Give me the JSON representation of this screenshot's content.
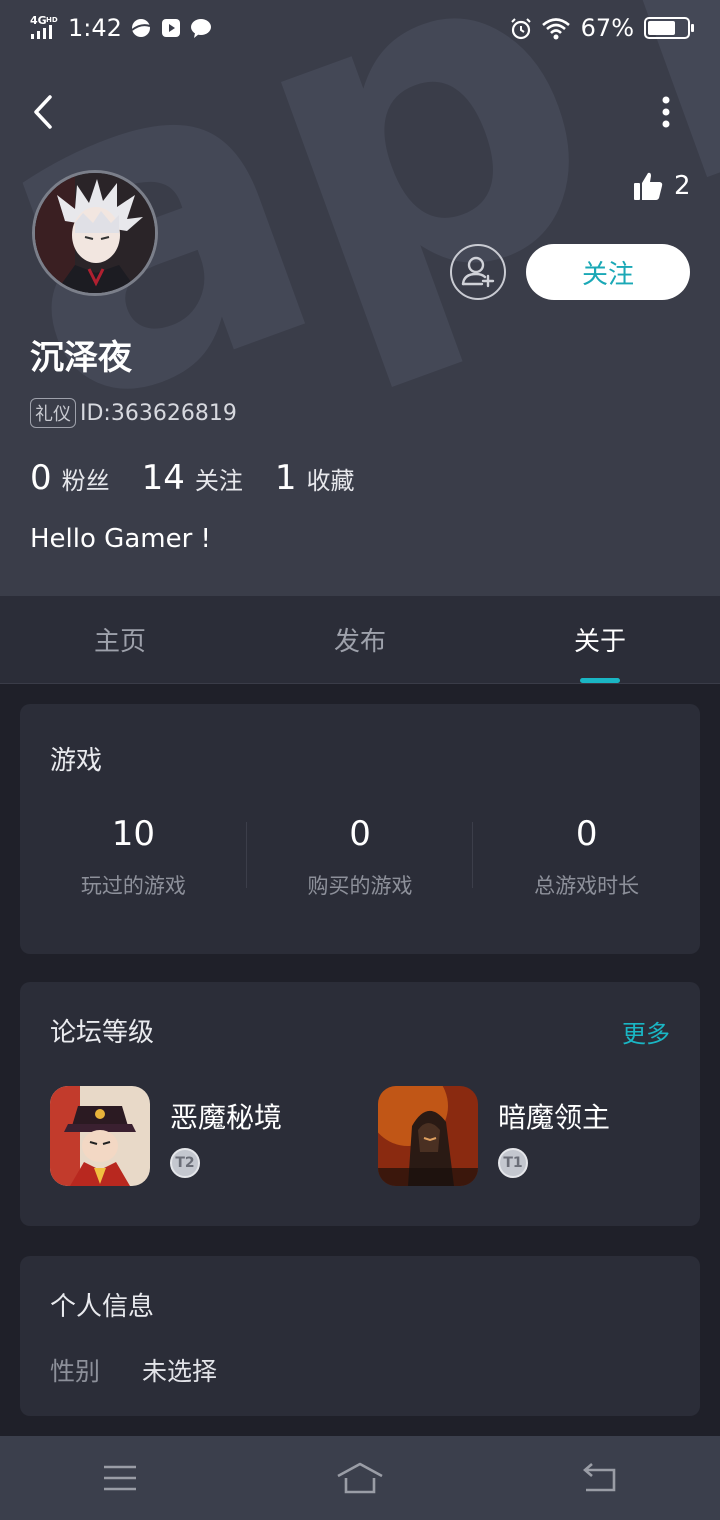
{
  "status_bar": {
    "network": "4G HD",
    "time": "1:42",
    "battery": "67%"
  },
  "profile": {
    "likes": "2",
    "follow_label": "关注",
    "username": "沉泽夜",
    "tag": "礼仪",
    "id_text": "ID:363626819",
    "stats": [
      {
        "num": "0",
        "label": "粉丝"
      },
      {
        "num": "14",
        "label": "关注"
      },
      {
        "num": "1",
        "label": "收藏"
      }
    ],
    "bio": "Hello Gamer !"
  },
  "tabs": [
    {
      "label": "主页"
    },
    {
      "label": "发布"
    },
    {
      "label": "关于"
    }
  ],
  "games_card": {
    "title": "游戏",
    "stats": [
      {
        "value": "10",
        "label": "玩过的游戏"
      },
      {
        "value": "0",
        "label": "购买的游戏"
      },
      {
        "value": "0",
        "label": "总游戏时长"
      }
    ]
  },
  "forum_card": {
    "title": "论坛等级",
    "more": "更多",
    "items": [
      {
        "name": "恶魔秘境",
        "icon": "game-icon-evil-secret-realm"
      },
      {
        "name": "暗魔领主",
        "icon": "game-icon-dark-lord"
      }
    ]
  },
  "personal_card": {
    "title": "个人信息",
    "label": "性别",
    "value": "未选择"
  },
  "colors": {
    "accent": "#1ab6c4",
    "header_bg": "#3a3d49",
    "page_bg": "#1f2029",
    "card_bg": "#2b2d38"
  }
}
